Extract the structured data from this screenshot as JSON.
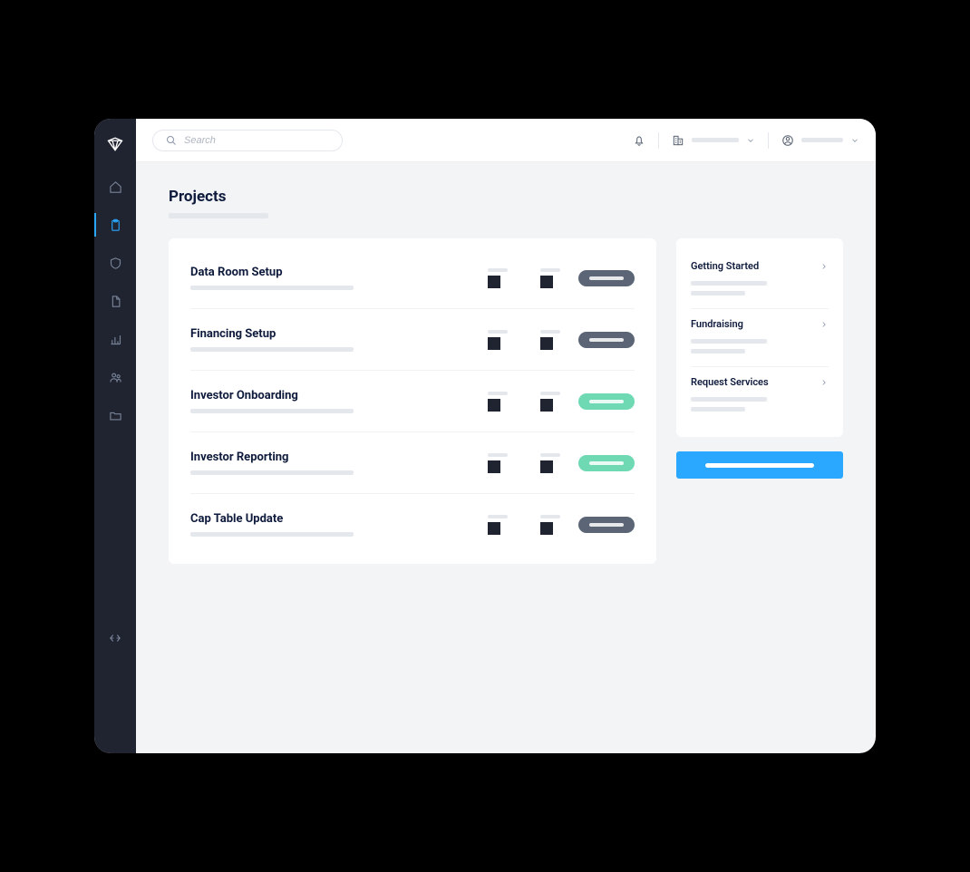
{
  "search": {
    "placeholder": "Search"
  },
  "page": {
    "title": "Projects"
  },
  "projects": [
    {
      "title": "Data Room Setup",
      "status": "gray"
    },
    {
      "title": "Financing Setup",
      "status": "gray"
    },
    {
      "title": "Investor Onboarding",
      "status": "green"
    },
    {
      "title": "Investor Reporting",
      "status": "green"
    },
    {
      "title": "Cap Table Update",
      "status": "gray"
    }
  ],
  "side_panels": [
    {
      "title": "Getting Started"
    },
    {
      "title": "Fundraising"
    },
    {
      "title": "Request Services"
    }
  ],
  "nav": [
    "home",
    "projects",
    "shield",
    "document",
    "chart",
    "team",
    "folder"
  ]
}
